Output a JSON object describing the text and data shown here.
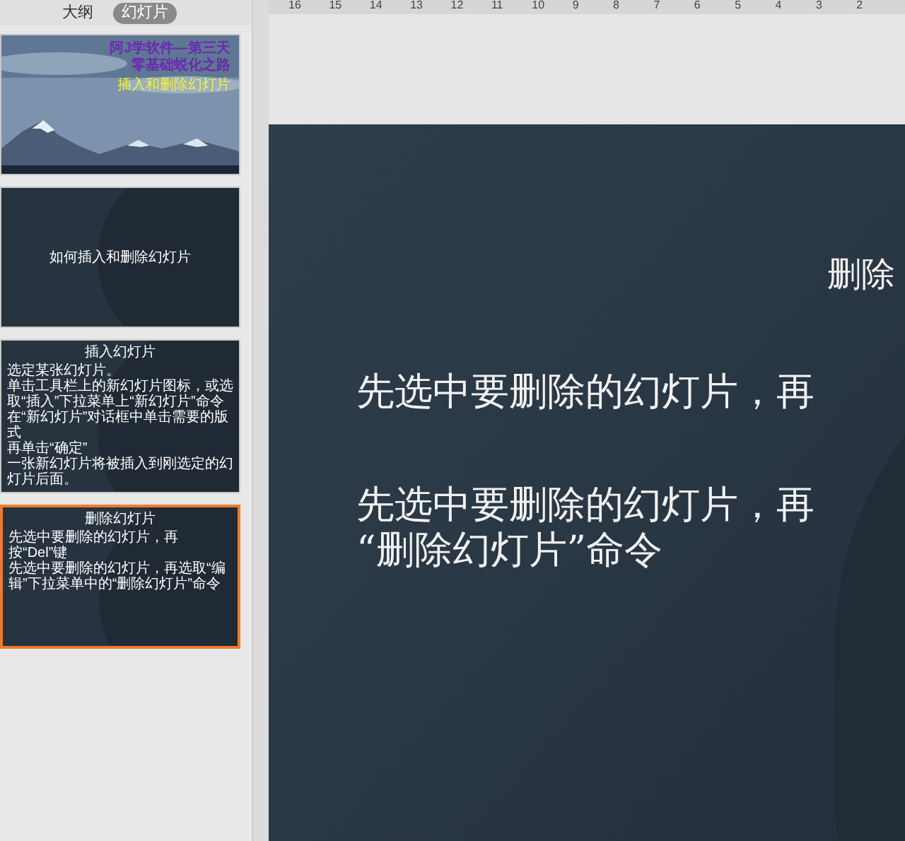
{
  "view_tabs": [
    {
      "label": "大纲",
      "selected": false
    },
    {
      "label": "幻灯片",
      "selected": true
    }
  ],
  "slides": [
    {
      "selected": false,
      "title_lines": [
        "阿J学软件—第三天",
        "零基础蜕化之路"
      ],
      "subtitle": "插入和删除幻灯片"
    },
    {
      "kind": "title",
      "selected": false,
      "title": "如何插入和删除幻灯片"
    },
    {
      "kind": "content",
      "selected": false,
      "title": "插入幻灯片",
      "lines": [
        "选定某张幻灯片。",
        "单击工具栏上的新幻灯片图标，或选取“插入”下拉菜单上“新幻灯片”命令",
        "在“新幻灯片”对话框中单击需要的版式",
        "再单击“确定”",
        "一张新幻灯片将被插入到刚选定的幻灯片后面。"
      ]
    },
    {
      "kind": "content",
      "selected": true,
      "title": "删除幻灯片",
      "lines": [
        "先选中要删除的幻灯片，再按“Del”键",
        "先选中要删除的幻灯片，再选取“编辑”下拉菜单中的“删除幻灯片”命令"
      ]
    }
  ],
  "ruler_labels": [
    "16",
    "15",
    "14",
    "13",
    "12",
    "11",
    "10",
    "9",
    "8",
    "7",
    "6",
    "5",
    "4",
    "3",
    "2"
  ],
  "current_slide": {
    "title": "删除",
    "paragraphs": [
      [
        "先选中要删除的幻灯片，再"
      ],
      [
        "先选中要删除的幻灯片，再",
        "“删除幻灯片”命令"
      ]
    ]
  }
}
